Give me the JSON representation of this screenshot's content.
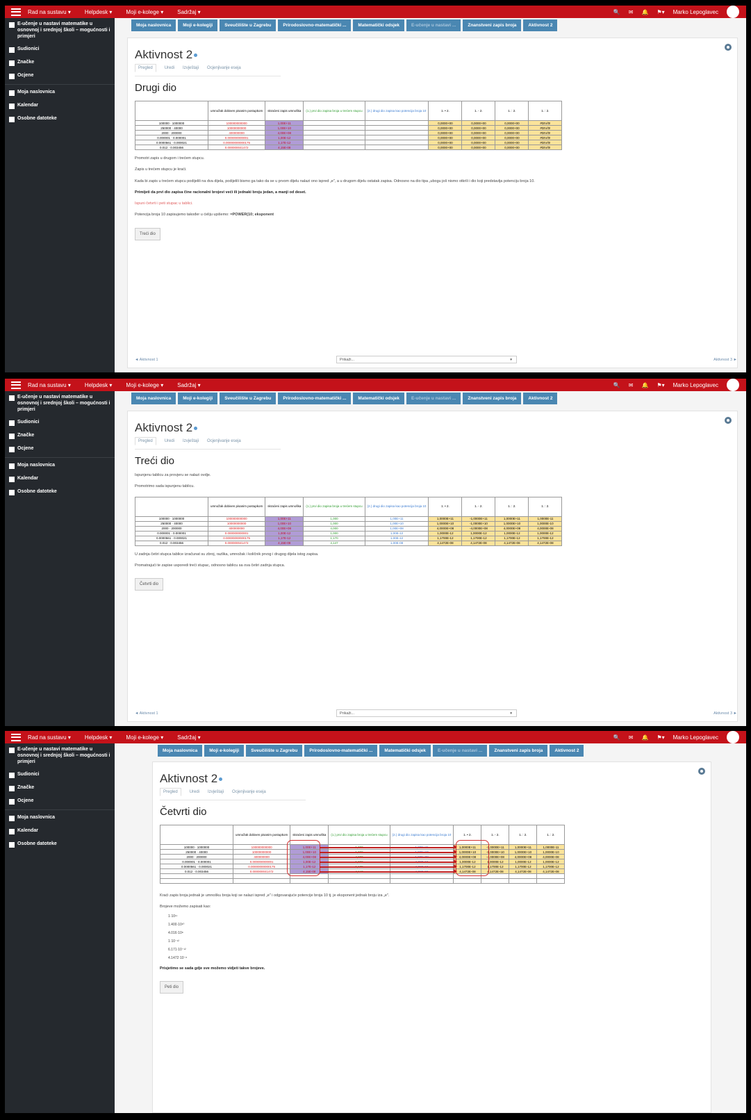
{
  "topbar": {
    "menus": [
      "Rad na sustavu ▾",
      "Helpdesk ▾",
      "Moji e-kolege ▾",
      "Sadržaj ▾"
    ],
    "user": "Marko Lepoglavec"
  },
  "sidebar": {
    "course": "E-učenje u nastavi matematike u osnovnoj i srednjoj školi – mogućnosti i primjeri",
    "items": [
      "Sudionici",
      "Značke",
      "Ocjene"
    ],
    "items2": [
      "Moja naslovnica",
      "Kalendar",
      "Osobne datoteke"
    ]
  },
  "crumbs": [
    "Moja naslovnica",
    "Moji e-kolegiji",
    "Sveučilište u Zagrebu",
    "Prirodoslovno-matematički ...",
    "Matematički odsjek",
    "E-učenje u nastavi ...",
    "Znanstveni zapis broja",
    "Aktivnost 2"
  ],
  "page": {
    "title": "Aktivnost 2",
    "tabs": [
      "Pregled",
      "Uredi",
      "Izvještaji",
      "Ocjenjivanje eseja"
    ],
    "select": "Prikaži...",
    "prev": "◄ Aktivnost 1",
    "next": "Aktivnost 3 ►"
  },
  "table": {
    "headers": [
      "umnožak dobiven pisanim postupkom",
      "skraćeni zapis umnoška",
      "(1.) prvi dio zapisa broja u trećem stupcu",
      "(2.) drugi dio zapisa kao potencija broja 10",
      "1. • 2.",
      "1. - 2.",
      "1. : 2.",
      "1. : 2."
    ],
    "rows": [
      "100000 · 1000000",
      "250000 · 40000",
      "2000 · 200000",
      "0.000001 · 0.000001",
      "0.0000561 · 0.000021",
      "0.012 · 0.003456"
    ],
    "exact": [
      "100000000000",
      "10000000000",
      "400000000",
      "0.000000000001",
      "0.00000000000175",
      "0.000000041472"
    ],
    "short": [
      "1,00E+11",
      "1,00E+10",
      "4,00E+08",
      "1,00E-12",
      "1,17E-12",
      "4,15E-08"
    ],
    "part1": [
      "1,000",
      "1,000",
      "4,000",
      "1,000",
      "1,170",
      "4,147"
    ],
    "part2": [
      "1,00E+11",
      "1,00E+10",
      "1,00E+08",
      "1,00E-12",
      "1,00E-12",
      "1,00E-08"
    ],
    "cmp_a": [
      "0,0000+00",
      "0,0000+00",
      "0,0000+00",
      "0,0000+00",
      "0,0000+00",
      "0,0000+00"
    ],
    "cmp_b": [
      "#DIV/0!",
      "#DIV/0!",
      "#DIV/0!",
      "#DIV/0!",
      "#DIV/0!",
      "#DIV/0!"
    ],
    "full": [
      [
        "1,0000E+11",
        "-1,0000E+11",
        "1,0000E+11",
        "1,0000E-11"
      ],
      [
        "1,0000E+10",
        "-1,0000E+10",
        "1,0000E+10",
        "1,0000E-10"
      ],
      [
        "4,0000E+08",
        "-4,0000E+08",
        "4,0000E+08",
        "4,0000E-08"
      ],
      [
        "1,0000E-12",
        "1,0000E-12",
        "1,0000E-12",
        "1,0000E-12"
      ],
      [
        "1,1700E-12",
        "1,1700E-12",
        "1,1700E-12",
        "1,1700E-12"
      ],
      [
        "4,1472E-08",
        "4,1472E-08",
        "4,1472E-08",
        "4,1472E-08"
      ]
    ]
  },
  "s1": {
    "heading": "Drugi dio",
    "p1": "Promotri zapis u drugom i trećem stupcu.",
    "p2": "Zapis u trećem stupcu je kraći.",
    "p3": "Kada bi zapis u trećem stupcu podijelili na dva dijela, podijelili bismo ga tako da se u prvom dijelu nalazi ono ispred „e\", a u drugom dijelu ostatak zapisa. Odnosno na dio tipa „ubogu još nismo otkrili i dio koji predstavlja potenciju broja 10.",
    "p4": "Primijeti da prvi dio zapisa čine racionalni brojevi veći ili jednaki broju jedan, a manji od deset.",
    "p5": "Ispuni četvrti i peti stupac u tablici.",
    "p6": "Potencija broja 10 zapisujemo također u ćeliju upišemo:",
    "p6b": "=POWER(10; eksponent",
    "btn": "Treći dio"
  },
  "s2": {
    "heading": "Treći dio",
    "p1": "Ispunjenu tablicu za provjeru se nalazi ovdje.",
    "p2": "Promotrimo sada ispunjenu tablicu.",
    "p3": "U zadnja četiri stupca tablice izračunat su zbroj, razlika, umnožak i količnik prvog i drugog dijela istog zapisa.",
    "p4": "Promatrajući te zapise usporedi treći stupac, odnosno tablicu sa ova četiri zadnja stupca.",
    "btn": "Četvrti dio"
  },
  "s3": {
    "heading": "Četvrti dio",
    "p1": "Kraći zapis broja jednak je umnošku broja koji se nalazi ispred „e\" i odgovarajuće potencije broja 10 tj. je eksponent jednak broju iza „e\".",
    "p2": "Brojeve možemo zapisati kao:",
    "pows": [
      "1·10¹¹",
      "1.400·10¹⁰",
      "4.016·10⁸",
      "1·10⁻¹²",
      "6.171·10⁻¹²",
      "4.1472·10⁻⁸"
    ],
    "p3": "Prisjetimo se sada gdje sve možemo vidjeti takve brojeve.",
    "btn": "Peti dio"
  }
}
